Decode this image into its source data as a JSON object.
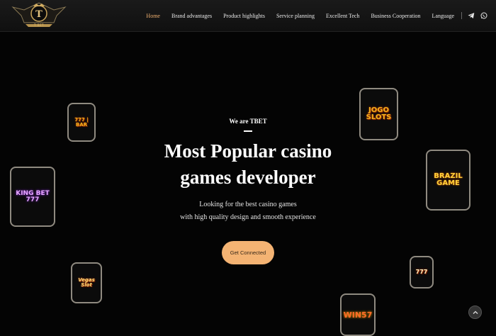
{
  "header": {
    "logo_text": "T BET",
    "nav": [
      {
        "label": "Home",
        "active": true
      },
      {
        "label": "Brand advantages",
        "active": false
      },
      {
        "label": "Product highlights",
        "active": false
      },
      {
        "label": "Service planning",
        "active": false
      },
      {
        "label": "Excellent Tech",
        "active": false
      },
      {
        "label": "Business Cooperation",
        "active": false
      },
      {
        "label": "Language",
        "active": false
      }
    ],
    "icons": [
      "telegram-icon",
      "whatsapp-icon"
    ]
  },
  "hero": {
    "tag": "We are TBET",
    "title_line1": "Most Popular casino",
    "title_line2": "games developer",
    "sub_line1": "Looking for the best casino games",
    "sub_line2": "with high quality design and smooth experience",
    "cta": "Get Connected"
  },
  "tiles": [
    {
      "name": "777-slot",
      "label": "777 | BAR"
    },
    {
      "name": "king-bet-777",
      "label": "KING BET 777"
    },
    {
      "name": "vegas-slot",
      "label": "Vegas Slot"
    },
    {
      "name": "jogo-slots",
      "label": "JOGO SLOTS"
    },
    {
      "name": "brazil-game",
      "label": "BRAZIL GAME"
    },
    {
      "name": "777-small",
      "label": "777"
    },
    {
      "name": "win57",
      "label": "WIN57"
    }
  ],
  "colors": {
    "accent": "#f4b373",
    "nav_active": "#f0b070",
    "background": "#040404"
  }
}
